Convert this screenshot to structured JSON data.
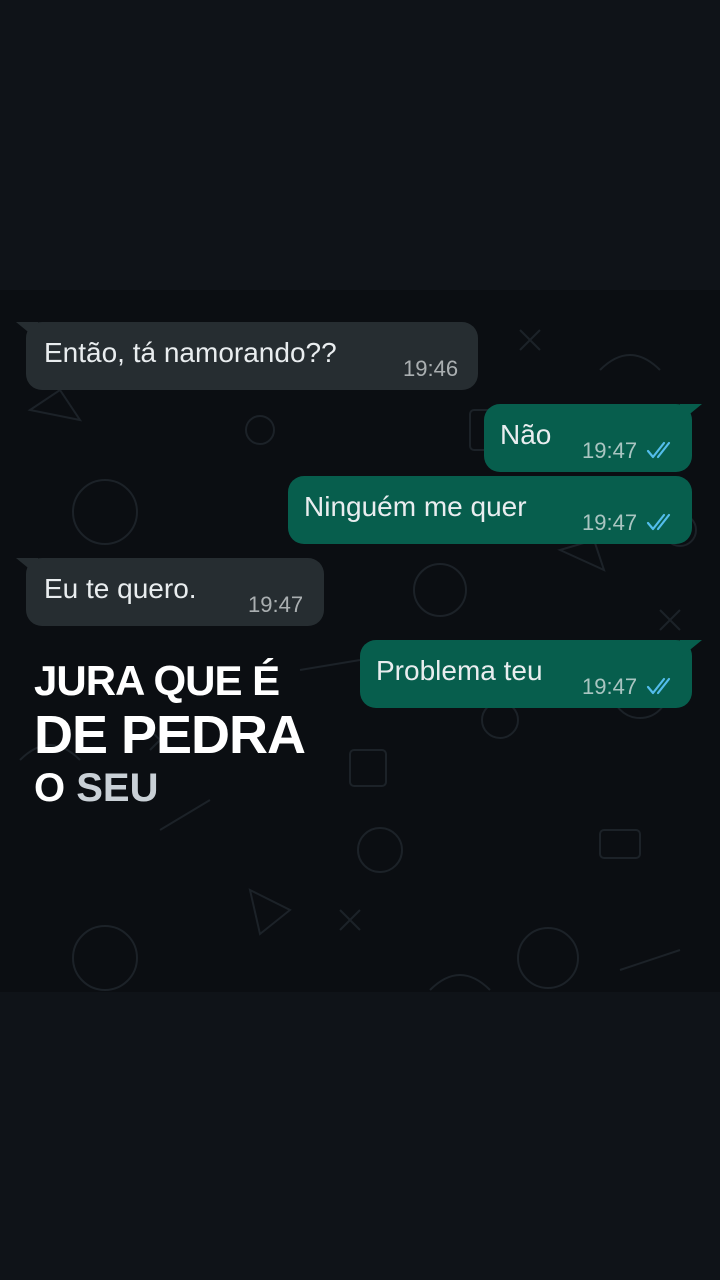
{
  "messages": [
    {
      "dir": "in",
      "text": "Então, tá namorando??",
      "time": "19:46"
    },
    {
      "dir": "out",
      "text": "Não",
      "time": "19:47",
      "status": "read-double-check-icon"
    },
    {
      "dir": "out",
      "text": "Ninguém me quer",
      "time": "19:47",
      "status": "read-double-check-icon"
    },
    {
      "dir": "in",
      "text": "Eu te quero.",
      "time": "19:47"
    },
    {
      "dir": "out",
      "text": "Problema teu",
      "time": "19:47",
      "status": "read-double-check-icon"
    }
  ],
  "caption": {
    "line1": "JURA QUE É",
    "line2": "DE PEDRA",
    "line3_a": "O",
    "line3_b": "SEU"
  },
  "colors": {
    "page_bg": "#0f1318",
    "chat_bg": "#0b0e12",
    "incoming_bubble": "#262d31",
    "outgoing_bubble": "#075e4d",
    "read_tick": "#53bdeb",
    "text": "#e9edef"
  }
}
